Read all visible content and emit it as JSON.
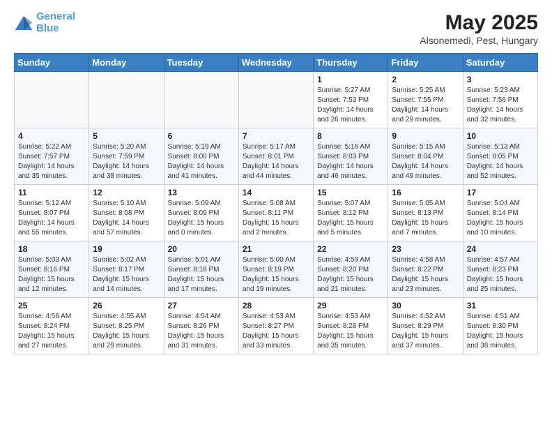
{
  "logo": {
    "line1": "General",
    "line2": "Blue"
  },
  "title": "May 2025",
  "subtitle": "Alsonemedi, Pest, Hungary",
  "weekdays": [
    "Sunday",
    "Monday",
    "Tuesday",
    "Wednesday",
    "Thursday",
    "Friday",
    "Saturday"
  ],
  "weeks": [
    [
      {
        "day": "",
        "info": ""
      },
      {
        "day": "",
        "info": ""
      },
      {
        "day": "",
        "info": ""
      },
      {
        "day": "",
        "info": ""
      },
      {
        "day": "1",
        "info": "Sunrise: 5:27 AM\nSunset: 7:53 PM\nDaylight: 14 hours\nand 26 minutes."
      },
      {
        "day": "2",
        "info": "Sunrise: 5:25 AM\nSunset: 7:55 PM\nDaylight: 14 hours\nand 29 minutes."
      },
      {
        "day": "3",
        "info": "Sunrise: 5:23 AM\nSunset: 7:56 PM\nDaylight: 14 hours\nand 32 minutes."
      }
    ],
    [
      {
        "day": "4",
        "info": "Sunrise: 5:22 AM\nSunset: 7:57 PM\nDaylight: 14 hours\nand 35 minutes."
      },
      {
        "day": "5",
        "info": "Sunrise: 5:20 AM\nSunset: 7:59 PM\nDaylight: 14 hours\nand 38 minutes."
      },
      {
        "day": "6",
        "info": "Sunrise: 5:19 AM\nSunset: 8:00 PM\nDaylight: 14 hours\nand 41 minutes."
      },
      {
        "day": "7",
        "info": "Sunrise: 5:17 AM\nSunset: 8:01 PM\nDaylight: 14 hours\nand 44 minutes."
      },
      {
        "day": "8",
        "info": "Sunrise: 5:16 AM\nSunset: 8:03 PM\nDaylight: 14 hours\nand 46 minutes."
      },
      {
        "day": "9",
        "info": "Sunrise: 5:15 AM\nSunset: 8:04 PM\nDaylight: 14 hours\nand 49 minutes."
      },
      {
        "day": "10",
        "info": "Sunrise: 5:13 AM\nSunset: 8:05 PM\nDaylight: 14 hours\nand 52 minutes."
      }
    ],
    [
      {
        "day": "11",
        "info": "Sunrise: 5:12 AM\nSunset: 8:07 PM\nDaylight: 14 hours\nand 55 minutes."
      },
      {
        "day": "12",
        "info": "Sunrise: 5:10 AM\nSunset: 8:08 PM\nDaylight: 14 hours\nand 57 minutes."
      },
      {
        "day": "13",
        "info": "Sunrise: 5:09 AM\nSunset: 8:09 PM\nDaylight: 15 hours\nand 0 minutes."
      },
      {
        "day": "14",
        "info": "Sunrise: 5:08 AM\nSunset: 8:11 PM\nDaylight: 15 hours\nand 2 minutes."
      },
      {
        "day": "15",
        "info": "Sunrise: 5:07 AM\nSunset: 8:12 PM\nDaylight: 15 hours\nand 5 minutes."
      },
      {
        "day": "16",
        "info": "Sunrise: 5:05 AM\nSunset: 8:13 PM\nDaylight: 15 hours\nand 7 minutes."
      },
      {
        "day": "17",
        "info": "Sunrise: 5:04 AM\nSunset: 8:14 PM\nDaylight: 15 hours\nand 10 minutes."
      }
    ],
    [
      {
        "day": "18",
        "info": "Sunrise: 5:03 AM\nSunset: 8:16 PM\nDaylight: 15 hours\nand 12 minutes."
      },
      {
        "day": "19",
        "info": "Sunrise: 5:02 AM\nSunset: 8:17 PM\nDaylight: 15 hours\nand 14 minutes."
      },
      {
        "day": "20",
        "info": "Sunrise: 5:01 AM\nSunset: 8:18 PM\nDaylight: 15 hours\nand 17 minutes."
      },
      {
        "day": "21",
        "info": "Sunrise: 5:00 AM\nSunset: 8:19 PM\nDaylight: 15 hours\nand 19 minutes."
      },
      {
        "day": "22",
        "info": "Sunrise: 4:59 AM\nSunset: 8:20 PM\nDaylight: 15 hours\nand 21 minutes."
      },
      {
        "day": "23",
        "info": "Sunrise: 4:58 AM\nSunset: 8:22 PM\nDaylight: 15 hours\nand 23 minutes."
      },
      {
        "day": "24",
        "info": "Sunrise: 4:57 AM\nSunset: 8:23 PM\nDaylight: 15 hours\nand 25 minutes."
      }
    ],
    [
      {
        "day": "25",
        "info": "Sunrise: 4:56 AM\nSunset: 8:24 PM\nDaylight: 15 hours\nand 27 minutes."
      },
      {
        "day": "26",
        "info": "Sunrise: 4:55 AM\nSunset: 8:25 PM\nDaylight: 15 hours\nand 29 minutes."
      },
      {
        "day": "27",
        "info": "Sunrise: 4:54 AM\nSunset: 8:26 PM\nDaylight: 15 hours\nand 31 minutes."
      },
      {
        "day": "28",
        "info": "Sunrise: 4:53 AM\nSunset: 8:27 PM\nDaylight: 15 hours\nand 33 minutes."
      },
      {
        "day": "29",
        "info": "Sunrise: 4:53 AM\nSunset: 8:28 PM\nDaylight: 15 hours\nand 35 minutes."
      },
      {
        "day": "30",
        "info": "Sunrise: 4:52 AM\nSunset: 8:29 PM\nDaylight: 15 hours\nand 37 minutes."
      },
      {
        "day": "31",
        "info": "Sunrise: 4:51 AM\nSunset: 8:30 PM\nDaylight: 15 hours\nand 38 minutes."
      }
    ]
  ]
}
